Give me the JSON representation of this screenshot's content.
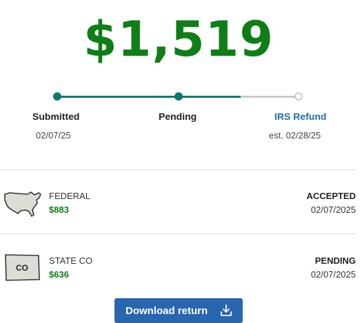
{
  "refund": {
    "amount": "$1,519"
  },
  "colors": {
    "progress": "#0b7a6b",
    "progress_pending": "#c7ccd1",
    "amount_green": "#0f7e17",
    "link_blue": "#236cb0",
    "button_blue": "#2966b0"
  },
  "tracker": {
    "progress_fraction": 0.76,
    "steps": [
      {
        "label": "Submitted",
        "date": "02/07/25",
        "state": "complete"
      },
      {
        "label": "Pending",
        "date": "",
        "state": "complete"
      },
      {
        "label": "IRS Refund",
        "date": "est. 02/28/25",
        "state": "upcoming"
      }
    ]
  },
  "returns": [
    {
      "icon": "usa-map-icon",
      "name": "FEDERAL",
      "amount": "$883",
      "status": "ACCEPTED",
      "date": "02/07/2025"
    },
    {
      "icon": "colorado-state-icon",
      "icon_text": "CO",
      "name": "STATE CO",
      "amount": "$636",
      "status": "PENDING",
      "date": "02/07/2025"
    }
  ],
  "actions": {
    "download_label": "Download return",
    "download_icon": "download-icon"
  }
}
